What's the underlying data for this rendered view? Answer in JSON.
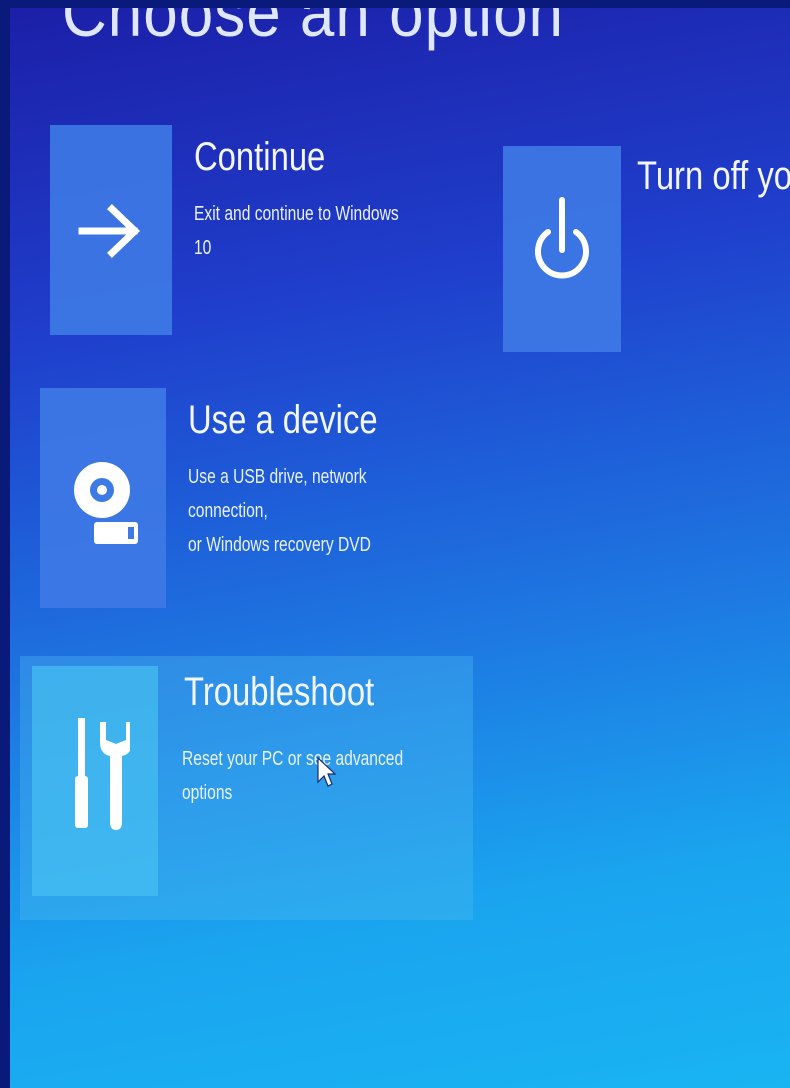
{
  "page": {
    "title": "Choose an option"
  },
  "options": [
    {
      "id": "continue",
      "title": "Continue",
      "description": "Exit and continue to Windows 10",
      "icon": "arrow-right-icon"
    },
    {
      "id": "turn-off",
      "title": "Turn off your P",
      "description": "",
      "icon": "power-icon"
    },
    {
      "id": "use-device",
      "title": "Use a device",
      "description": "Use a USB drive, network connection,\nor Windows recovery DVD",
      "icon": "disc-drive-icon"
    },
    {
      "id": "troubleshoot",
      "title": "Troubleshoot",
      "description": "Reset your PC or see advanced options",
      "icon": "tools-icon",
      "state": "hovered"
    }
  ],
  "colors": {
    "background_top": "#1c1fa8",
    "background_bottom": "#19b4f2",
    "tile": "#3e7ae6",
    "tile_hover": "#46bef0",
    "text": "#ffffff"
  }
}
